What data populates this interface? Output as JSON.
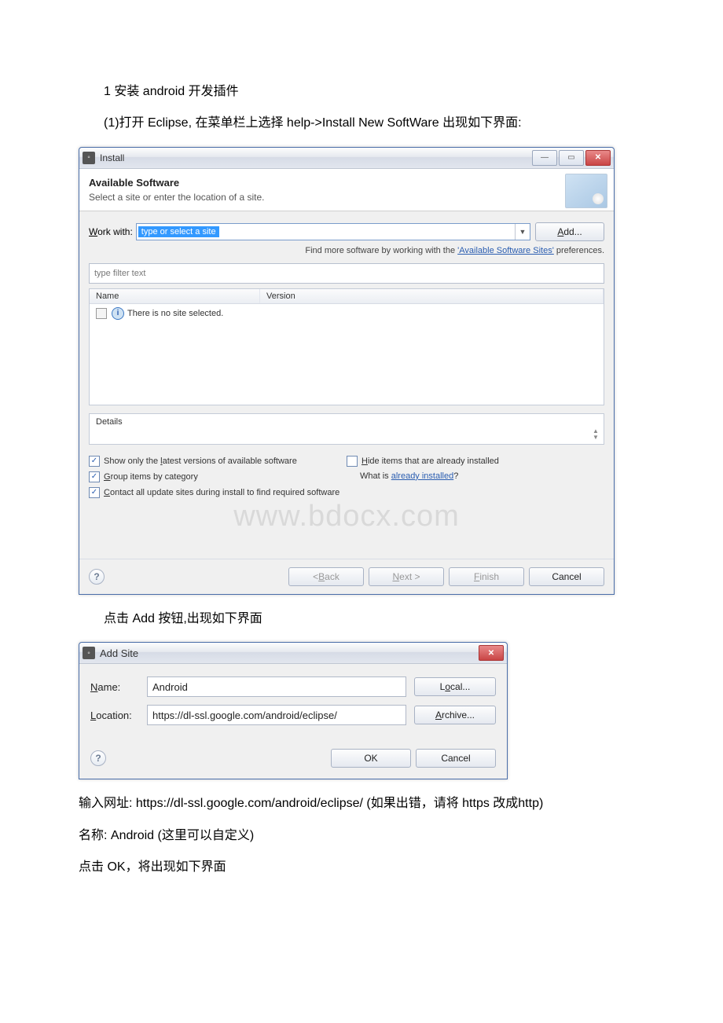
{
  "doc": {
    "step_title": "1 安装 android 开发插件",
    "step_desc": " (1)打开 Eclipse, 在菜单栏上选择 help->Install New SoftWare 出现如下界面:",
    "after_install_img": "  点击 Add 按钮,出现如下界面",
    "enter_url": "    输入网址: https://dl-ssl.google.com/android/eclipse/    (如果出错，请将 https 改成http)",
    "enter_name": "    名称: Android (这里可以自定义)",
    "click_ok": "   点击 OK，将出现如下界面"
  },
  "install": {
    "title": "Install",
    "banner_title": "Available Software",
    "banner_desc": "Select a site or enter the location of a site.",
    "work_with_label_pre": "W",
    "work_with_label_post": "ork with:",
    "work_with_value": "type or select a site",
    "add_btn_pre": "A",
    "add_btn_post": "dd...",
    "hint_pre": "Find more software by working with the ",
    "hint_link": "'Available Software Sites'",
    "hint_post": " preferences.",
    "filter_placeholder": "type filter text",
    "col_name": "Name",
    "col_version": "Version",
    "info_icon": "i",
    "no_site_text": "There is no site selected.",
    "details_label": "Details",
    "opt_latest_pre": "Show only the ",
    "opt_latest_u": "l",
    "opt_latest_post": "atest versions of available software",
    "opt_group_pre": "G",
    "opt_group_post": "roup items by category",
    "opt_contact_pre": "C",
    "opt_contact_post": "ontact all update sites during install to find required software",
    "opt_hide_pre": "H",
    "opt_hide_post": "ide items that are already installed",
    "what_is_text": "What is ",
    "what_is_link": "already installed",
    "what_is_q": "?",
    "watermark": "www.bdocx.com",
    "btn_back_pre": "< ",
    "btn_back_u": "B",
    "btn_back_post": "ack",
    "btn_next_u": "N",
    "btn_next_post": "ext >",
    "btn_finish_u": "F",
    "btn_finish_post": "inish",
    "btn_cancel": "Cancel"
  },
  "addsite": {
    "title": "Add Site",
    "name_label_u": "N",
    "name_label_post": "ame:",
    "name_value": "Android",
    "loc_label_u": "L",
    "loc_label_post": "ocation:",
    "loc_value": "https://dl-ssl.google.com/android/eclipse/",
    "local_btn_pre": "L",
    "local_btn_u": "o",
    "local_btn_post": "cal...",
    "archive_u": "A",
    "archive_post": "rchive...",
    "ok": "OK",
    "cancel": "Cancel"
  }
}
